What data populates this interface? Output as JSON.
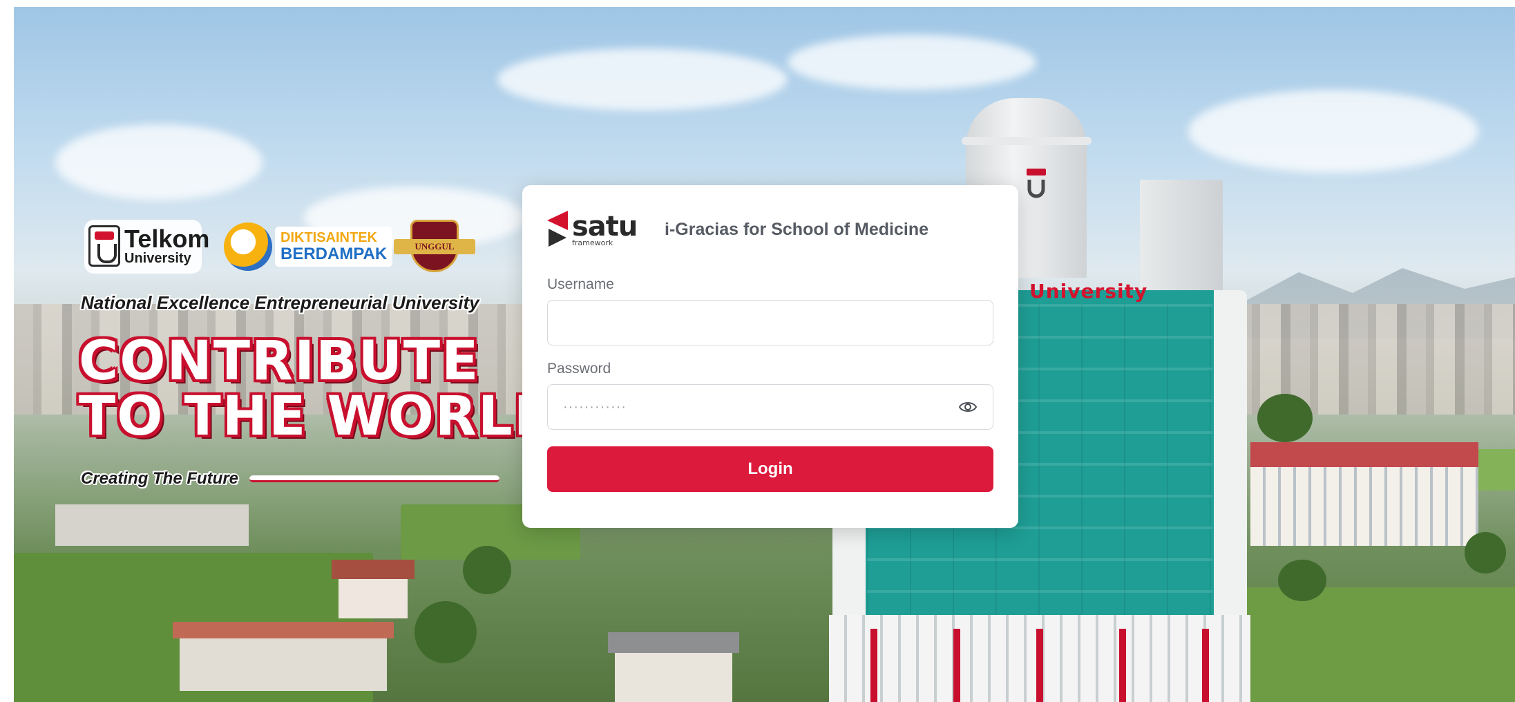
{
  "background": {
    "brand": {
      "telkom_name": "Telkom",
      "telkom_sub": "University",
      "dikti_line1": "DIKTISAINTEK",
      "dikti_line2": "BERDAMPAK",
      "unggul_label": "UNGGUL"
    },
    "tagline": "National Excellence Entrepreneurial University",
    "headline_line1": "CONTRIBUTE",
    "headline_line2": "TO THE WORLD",
    "subtag": "Creating The Future",
    "building_sign": "University"
  },
  "login": {
    "logo_name": "satu",
    "logo_sub": "framework",
    "app_title": "i-Gracias for School of Medicine",
    "username_label": "Username",
    "username_value": "",
    "password_label": "Password",
    "password_placeholder": "············",
    "login_button": "Login"
  },
  "colors": {
    "accent": "#dc1a3c",
    "brand_red": "#c8102e",
    "tower_glass": "#1e9e95"
  },
  "icons": {
    "password_toggle": "eye-icon"
  }
}
